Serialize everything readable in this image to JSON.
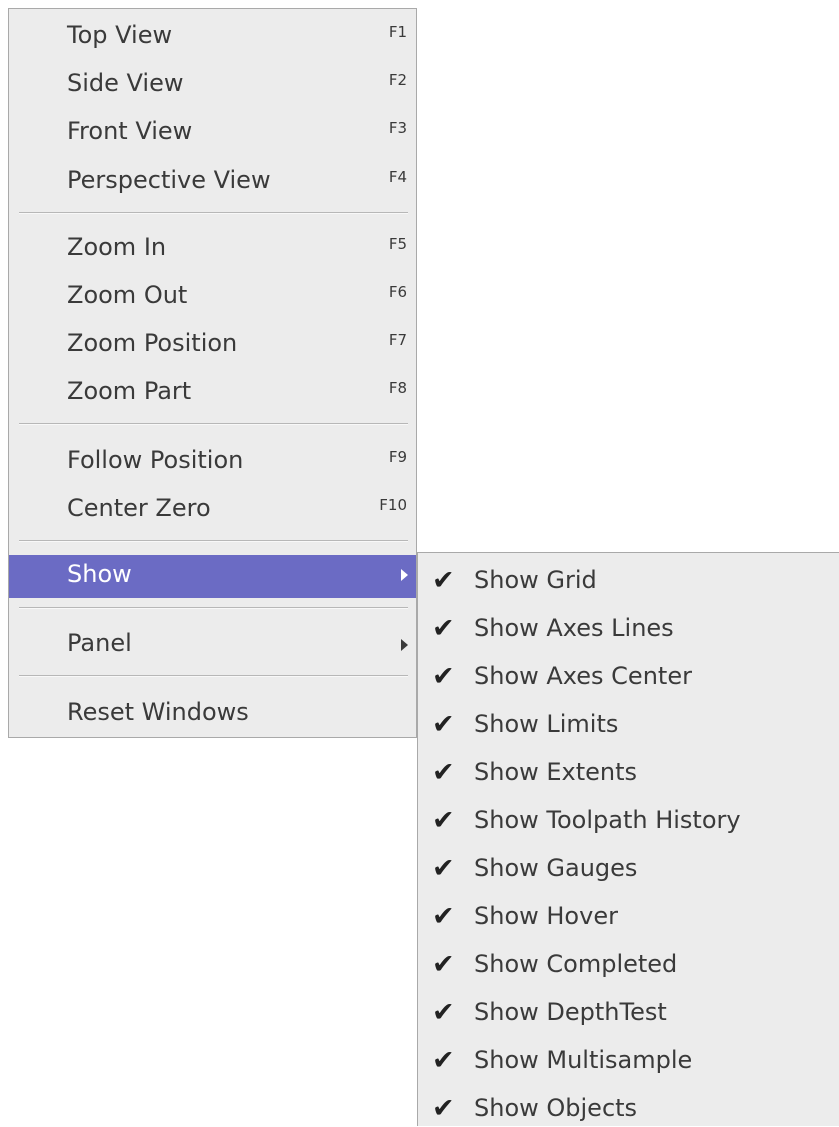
{
  "main_menu": {
    "items": [
      {
        "label": "Top View",
        "shortcut": "F1"
      },
      {
        "label": "Side View",
        "shortcut": "F2"
      },
      {
        "label": "Front View",
        "shortcut": "F3"
      },
      {
        "label": "Perspective View",
        "shortcut": "F4"
      },
      {
        "label": "Zoom In",
        "shortcut": "F5"
      },
      {
        "label": "Zoom Out",
        "shortcut": "F6"
      },
      {
        "label": "Zoom Position",
        "shortcut": "F7"
      },
      {
        "label": "Zoom Part",
        "shortcut": "F8"
      },
      {
        "label": "Follow Position",
        "shortcut": "F9"
      },
      {
        "label": "Center Zero",
        "shortcut": "F10"
      },
      {
        "label": "Show",
        "has_submenu": true,
        "highlighted": true
      },
      {
        "label": "Panel",
        "has_submenu": true
      },
      {
        "label": "Reset Windows"
      }
    ]
  },
  "show_submenu": {
    "items": [
      {
        "label": "Show Grid",
        "checked": true,
        "check_icon": "checkmark-icon"
      },
      {
        "label": "Show Axes Lines",
        "checked": true,
        "check_icon": "checkmark-icon"
      },
      {
        "label": "Show Axes Center",
        "checked": true,
        "check_icon": "checkmark-icon"
      },
      {
        "label": "Show Limits",
        "checked": true,
        "check_icon": "checkmark-icon"
      },
      {
        "label": "Show Extents",
        "checked": true,
        "check_icon": "checkmark-icon"
      },
      {
        "label": "Show Toolpath History",
        "checked": true,
        "check_icon": "checkmark-icon"
      },
      {
        "label": "Show Gauges",
        "checked": true,
        "check_icon": "checkmark-icon"
      },
      {
        "label": "Show Hover",
        "checked": true,
        "check_icon": "checkmark-icon"
      },
      {
        "label": "Show Completed",
        "checked": true,
        "check_icon": "checkmark-icon"
      },
      {
        "label": "Show DepthTest",
        "checked": true,
        "check_icon": "checkmark-icon"
      },
      {
        "label": "Show Multisample",
        "checked": true,
        "check_icon": "checkmark-icon"
      },
      {
        "label": "Show Objects",
        "checked": true,
        "check_icon": "checkmark-icon"
      }
    ],
    "check_glyph": "✔"
  },
  "colors": {
    "menu_background": "#ececec",
    "highlight": "#6b6bc4",
    "text": "#3a3a3a",
    "highlight_text": "#ffffff"
  }
}
